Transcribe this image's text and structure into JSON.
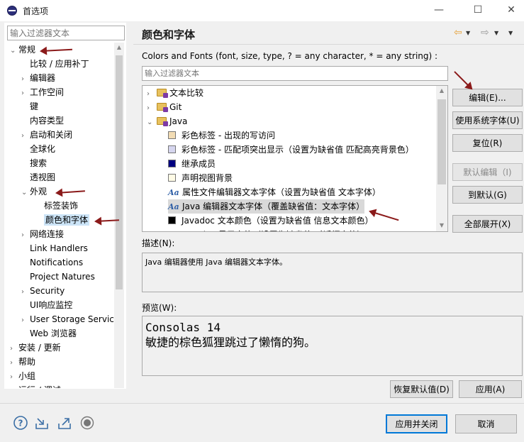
{
  "window": {
    "title": "首选项",
    "minimize_icon": "—",
    "maximize_icon": "☐",
    "close_icon": "✕"
  },
  "left": {
    "filter_placeholder": "输入过滤器文本",
    "tree": [
      {
        "label": "常规",
        "level": 0,
        "expanded": true
      },
      {
        "label": "比较 / 应用补丁",
        "level": 1
      },
      {
        "label": "编辑器",
        "level": 1,
        "collapsed": true
      },
      {
        "label": "工作空间",
        "level": 1,
        "collapsed": true
      },
      {
        "label": "键",
        "level": 1
      },
      {
        "label": "内容类型",
        "level": 1
      },
      {
        "label": "启动和关闭",
        "level": 1,
        "collapsed": true
      },
      {
        "label": "全球化",
        "level": 1
      },
      {
        "label": "搜索",
        "level": 1
      },
      {
        "label": "透视图",
        "level": 1
      },
      {
        "label": "外观",
        "level": 1,
        "expanded": true
      },
      {
        "label": "标签装饰",
        "level": 2
      },
      {
        "label": "颜色和字体",
        "level": 2,
        "selected": true
      },
      {
        "label": "网络连接",
        "level": 1,
        "collapsed": true
      },
      {
        "label": "Link Handlers",
        "level": 1
      },
      {
        "label": "Notifications",
        "level": 1
      },
      {
        "label": "Project Natures",
        "level": 1
      },
      {
        "label": "Security",
        "level": 1,
        "collapsed": true
      },
      {
        "label": "UI响应监控",
        "level": 1
      },
      {
        "label": "User Storage Servic",
        "level": 1,
        "collapsed": true
      },
      {
        "label": "Web 浏览器",
        "level": 1
      },
      {
        "label": "安装 / 更新",
        "level": 0,
        "collapsed": true
      },
      {
        "label": "帮助",
        "level": 0,
        "collapsed": true
      },
      {
        "label": "小组",
        "level": 0,
        "collapsed": true
      },
      {
        "label": "运行 / 调试",
        "level": 0,
        "collapsed": true
      }
    ]
  },
  "right": {
    "title": "颜色和字体",
    "nav": {
      "back": "⇦",
      "forward": "⇨",
      "dropdown": "▼",
      "menu": "▼"
    },
    "section_desc": "Colors and Fonts (font, size, type, ? = any character, * = any string) :",
    "filter_placeholder": "输入过滤器文本",
    "font_tree": [
      {
        "label": "文本比较",
        "level": 0,
        "icon": "folder",
        "collapsed": true
      },
      {
        "label": "Git",
        "level": 0,
        "icon": "folder",
        "collapsed": true
      },
      {
        "label": "Java",
        "level": 0,
        "icon": "folder",
        "expanded": true
      },
      {
        "label": "彩色标签 - 出现的写访问",
        "level": 1,
        "icon": "swatch",
        "color": "#f2dcb4"
      },
      {
        "label": "彩色标签 - 匹配项突出显示（设置为缺省值 匹配高亮背景色）",
        "level": 1,
        "icon": "swatch",
        "color": "#d6d6ef"
      },
      {
        "label": "继承成员",
        "level": 1,
        "icon": "swatch",
        "color": "#000080"
      },
      {
        "label": "声明视图背景",
        "level": 1,
        "icon": "swatch",
        "color": "#fffbe6"
      },
      {
        "label": "属性文件编辑器文本字体（设置为缺省值 文本字体）",
        "level": 1,
        "icon": "font"
      },
      {
        "label": "Java 编辑器文本字体（覆盖缺省值：文本字体）",
        "level": 1,
        "icon": "font",
        "selected": true
      },
      {
        "label": "Javadoc 文本颜色（设置为缺省值 信息文本颜色）",
        "level": 1,
        "icon": "swatch",
        "color": "#000000"
      },
      {
        "label": "Javadoc 显示字体（设置为缺省值 对话框字体）",
        "level": 1,
        "icon": "font"
      }
    ],
    "font_icon_text": "Aa",
    "buttons": {
      "edit": "编辑(E)...",
      "use_system_font": "使用系统字体(U)",
      "reset": "复位(R)",
      "edit_default": "默认编辑（I)",
      "goto_default": "到默认(G)",
      "expand_all": "全部展开(X)"
    },
    "description_label": "描述(N):",
    "description_text": "Java 编辑器使用 Java 编辑器文本字体。",
    "preview_label": "预览(W):",
    "preview_line1": "Consolas 14",
    "preview_line2": "敏捷的棕色狐狸跳过了懒惰的狗。",
    "restore_defaults": "恢复默认值(D)",
    "apply": "应用(A)"
  },
  "footer": {
    "apply_close": "应用并关闭",
    "cancel": "取消",
    "icons": [
      "help-icon",
      "import-icon",
      "export-icon",
      "oomph-icon"
    ]
  }
}
